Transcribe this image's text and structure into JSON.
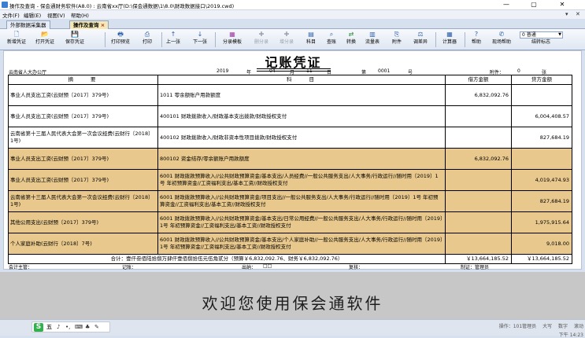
{
  "window": {
    "title": "操作及查询 - 保会通财务软件(A8.0) : 云南省xx厅(D:\\保会通数据\\1\\8.0\\财政数据接口\\2019.cwd)",
    "controls": [
      "—",
      "▢",
      "✕"
    ]
  },
  "menu": {
    "items": [
      "文件(F)",
      "编辑(E)",
      "视图(V)",
      "帮助(H)"
    ],
    "right_controls": [
      "▾",
      "✕"
    ]
  },
  "tabs": [
    {
      "label": "外部数据采集器",
      "active": false
    },
    {
      "label": "操作及查询",
      "active": true,
      "close": "×"
    }
  ],
  "toolbar": {
    "buttons": [
      {
        "label": "新增凭证",
        "icon": "new-voucher-icon",
        "glyph": "🗋"
      },
      {
        "label": "打开凭证",
        "icon": "open-voucher-icon",
        "glyph": "📂"
      },
      {
        "label": "保存凭证",
        "icon": "save-voucher-icon",
        "glyph": "💾"
      },
      {
        "label": "打印预览",
        "icon": "print-preview-icon",
        "glyph": "🖶"
      },
      {
        "label": "打印",
        "icon": "print-icon",
        "glyph": "⎙"
      },
      {
        "label": "上一张",
        "icon": "up-arrow-icon",
        "glyph": "↑"
      },
      {
        "label": "下一张",
        "icon": "down-arrow-icon",
        "glyph": "↓"
      },
      {
        "label": "分录模板",
        "icon": "template-icon",
        "glyph": "▦"
      },
      {
        "label": "删分录",
        "icon": "delete-entry-icon",
        "glyph": "✚",
        "disabled": true
      },
      {
        "label": "增分录",
        "icon": "add-entry-icon",
        "glyph": "✚",
        "disabled": true
      },
      {
        "label": "科目",
        "icon": "subject-icon",
        "glyph": "▤"
      },
      {
        "label": "查账",
        "icon": "search-icon",
        "glyph": "⌕"
      },
      {
        "label": "转换",
        "icon": "convert-icon",
        "glyph": "⇄"
      },
      {
        "label": "流量表",
        "icon": "flow-table-icon",
        "glyph": "▥"
      },
      {
        "label": "附件",
        "icon": "attachment-icon",
        "glyph": "⎘"
      },
      {
        "label": "调差异",
        "icon": "adjust-icon",
        "glyph": "⚖"
      },
      {
        "label": "计算器",
        "icon": "calculator-icon",
        "glyph": "▦"
      },
      {
        "label": "帮助",
        "icon": "help-icon",
        "glyph": "?"
      },
      {
        "label": "现场帮助",
        "icon": "onsite-help-icon",
        "glyph": "✆"
      },
      {
        "label": "结转标志",
        "icon": "carry-over-icon",
        "glyph": ""
      }
    ],
    "standard_select": "0 普通"
  },
  "voucher": {
    "title": "记账凭证",
    "unit": "云南省人大办公厅",
    "year": "2019",
    "year_label": "年",
    "month": "04",
    "month_label": "月",
    "day": "11",
    "day_label": "日",
    "number_label": "第",
    "number": "0001",
    "number_suffix": "号",
    "attachment_label": "附件：",
    "attachment_count": "0",
    "attachment_suffix": "张",
    "columns": [
      "摘　　要",
      "科　　目",
      "借方金额",
      "贷方金额"
    ],
    "rows": [
      {
        "summary": "事业人员支出工资(云财预〔2017〕379号)",
        "subject": "1011 零余额账户用款额度",
        "debit": "6,832,092.76",
        "credit": "",
        "selected": false
      },
      {
        "summary": "事业人员支出工资(云财预〔2017〕379号)",
        "subject": "400101 财政拨款收入/财政基本支出拨款/财政授权支付",
        "debit": "",
        "credit": "6,004,408.57",
        "selected": false
      },
      {
        "summary": "云南省第十三届人民代表大会第一次会议经费(云财行〔2018〕1号)",
        "subject": "400102 财政拨款收入/财政非资本性项目拨款/财政授权支付",
        "debit": "",
        "credit": "827,684.19",
        "selected": false
      },
      {
        "summary": "事业人员支出工资(云财预〔2017〕379号)",
        "subject": "800102 资金结存/零余额账户用款额度",
        "debit": "6,832,092.76",
        "credit": "",
        "selected": true
      },
      {
        "summary": "事业人员支出工资(云财预〔2017〕379号)",
        "subject": "6001 财政拨款预算收入//公共财政预算资金/基本支出/人员经费//一般公共服务支出/人大事务/行政运行//随时用〔2019〕1号 年初预算资金//工资福利支出/基本工资//财政授权支付",
        "debit": "",
        "credit": "4,019,474.93",
        "selected": true
      },
      {
        "summary": "云南省第十三届人民代表大会第一次会议经费(云财行〔2018〕1号)",
        "subject": "6001 财政拨款预算收入//公共财政预算资金/项目支出//一般公共服务支出/人大事务/行政运行//随时用〔2019〕1号 年初预算资金//工资福利支出/基本工资//财政授权支付",
        "debit": "",
        "credit": "827,684.19",
        "selected": true
      },
      {
        "summary": "其他公用支出(云财预〔2017〕379号)",
        "subject": "6001 财政拨款预算收入//公共财政预算资金/基本支出/日常公用经费//一般公共服务支出/人大事务/行政运行//随时用〔2019〕1号 年初预算资金//工资福利支出/基本工资//财政授权支付",
        "debit": "",
        "credit": "1,975,915.64",
        "selected": true
      },
      {
        "summary": "个人家庭补助(云财行〔2018〕7号)",
        "subject": "6001 财政拨款预算收入//公共财政预算资金/基本支出/个人家庭补助//一般公共服务支出/人大事务/行政运行//随时用〔2019〕1号 年初预算资金//工资福利支出/基本工资//财政授权支付",
        "debit": "",
        "credit": "9,018.00",
        "selected": true
      }
    ],
    "total_text": "合计：壹仟叁佰陆拾捌万肆仟壹佰捌拾伍元伍角贰分（预算￥6,832,092.76、财务￥6,832,092.76）",
    "total_debit": "￥13,664,185.52",
    "total_credit": "￥13,664,185.52",
    "footer": {
      "supervisor": "会计主管：",
      "bookkeeper": "记账：",
      "cashier": "出纳：",
      "cashier_marks": "□□",
      "reviewer": "复核：",
      "preparer": "制证：管理员"
    }
  },
  "welcome": "欢迎您使用保会通软件",
  "statusbar": {
    "operator": "操作：101管理员",
    "caps": "大写",
    "num": "数字",
    "scroll": "滚动",
    "time": "下午 14:23"
  },
  "ime": {
    "logo": "S",
    "mode": "五",
    "glyphs": [
      "♪",
      "•,",
      "⌨",
      "♣",
      "✎"
    ]
  }
}
